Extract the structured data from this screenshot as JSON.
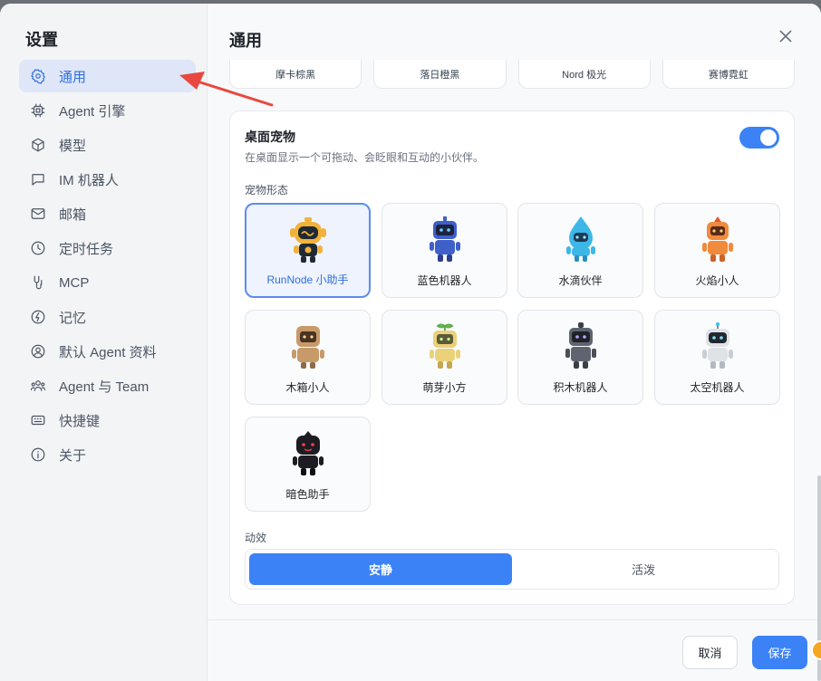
{
  "sidebar": {
    "title": "设置",
    "items": [
      {
        "label": "通用",
        "icon": "gear-icon",
        "active": true
      },
      {
        "label": "Agent 引擎",
        "icon": "chip-icon",
        "active": false
      },
      {
        "label": "模型",
        "icon": "cube-icon",
        "active": false
      },
      {
        "label": "IM 机器人",
        "icon": "chat-icon",
        "active": false
      },
      {
        "label": "邮箱",
        "icon": "mail-icon",
        "active": false
      },
      {
        "label": "定时任务",
        "icon": "clock-icon",
        "active": false
      },
      {
        "label": "MCP",
        "icon": "plug-icon",
        "active": false
      },
      {
        "label": "记忆",
        "icon": "memory-icon",
        "active": false
      },
      {
        "label": "默认 Agent 资料",
        "icon": "user-circle-icon",
        "active": false
      },
      {
        "label": "Agent 与 Team",
        "icon": "team-icon",
        "active": false
      },
      {
        "label": "快捷键",
        "icon": "keyboard-icon",
        "active": false
      },
      {
        "label": "关于",
        "icon": "info-icon",
        "active": false
      }
    ]
  },
  "main": {
    "title": "通用",
    "themes": [
      "摩卡棕黑",
      "落日橙黑",
      "Nord 极光",
      "赛博霓虹"
    ],
    "pet": {
      "title": "桌面宠物",
      "description": "在桌面显示一个可拖动、会眨眼和互动的小伙伴。",
      "enabled": true,
      "form_label": "宠物形态",
      "options": [
        {
          "name": "RunNode 小助手",
          "selected": true,
          "color": "#f2b23a"
        },
        {
          "name": "蓝色机器人",
          "selected": false,
          "color": "#3f5fc9"
        },
        {
          "name": "水滴伙伴",
          "selected": false,
          "color": "#3cb7e8"
        },
        {
          "name": "火焰小人",
          "selected": false,
          "color": "#f08a3c"
        },
        {
          "name": "木箱小人",
          "selected": false,
          "color": "#c79a6a"
        },
        {
          "name": "萌芽小方",
          "selected": false,
          "color": "#e9d27a"
        },
        {
          "name": "积木机器人",
          "selected": false,
          "color": "#5f6570"
        },
        {
          "name": "太空机器人",
          "selected": false,
          "color": "#dfe3e8"
        },
        {
          "name": "暗色助手",
          "selected": false,
          "color": "#1c1c22"
        }
      ]
    },
    "animation": {
      "label": "动效",
      "options": [
        "安静",
        "活泼"
      ],
      "selected": "安静"
    }
  },
  "footer": {
    "cancel_label": "取消",
    "save_label": "保存"
  },
  "colors": {
    "accent": "#3b82f6",
    "annotation_arrow": "#e8483f"
  }
}
